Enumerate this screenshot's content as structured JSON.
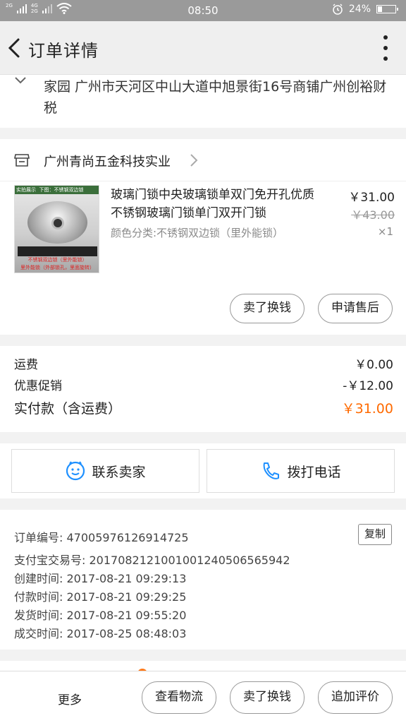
{
  "status_bar": {
    "network1": "2G",
    "network2a": "4G",
    "network2b": "2G",
    "time": "08:50",
    "battery_percent": "24%",
    "battery_level": 0.24
  },
  "header": {
    "title": "订单详情"
  },
  "address": {
    "text": "家园 广州市天河区中山大道中旭景街16号商铺广州创裕财税"
  },
  "shop": {
    "name": "广州青尚五金科技实业"
  },
  "product": {
    "image_tag": "实拍展示",
    "image_tag2": "下图：不锈钢双边锁",
    "image_caption1": "不锈钢双边锁（里外能锁）",
    "image_caption2": "里外能锁（外部锁孔，里面旋转）",
    "title": "玻璃门锁中央玻璃锁单双门免开孔优质不锈钢玻璃门锁单门双开门锁",
    "sku": "颜色分类:不锈钢双边锁（里外能锁）",
    "price": "￥31.00",
    "original_price": "￥43.00",
    "quantity": "×1",
    "btn_refund": "卖了换钱",
    "btn_aftersale": "申请售后"
  },
  "fees": {
    "shipping_label": "运费",
    "shipping_value": "￥0.00",
    "discount_label": "优惠促销",
    "discount_value": "-￥12.00",
    "total_label": "实付款（含运费）",
    "total_value": "￥31.00"
  },
  "contact": {
    "seller_label": "联系卖家",
    "call_label": "拨打电话"
  },
  "order_info": {
    "order_no": "订单编号: 470059761269147​25",
    "alipay_no": "支付宝交易号: 2017082121001001240506565942",
    "created": "创建时间: 2017-08-21 09:29:13",
    "paid": "付款时间: 2017-08-21 09:29:25",
    "shipped": "发货时间: 2017-08-21 09:55:20",
    "completed": "成交时间: 2017-08-25 08:48:03",
    "copy_label": "复制"
  },
  "bottom_bar": {
    "more_label": "更多",
    "logistics_label": "查看物流",
    "sell_label": "卖了换钱",
    "review_label": "追加评价"
  },
  "colors": {
    "accent": "#ff6a00",
    "contact_icon": "#1e90ff",
    "status_bar": "#9a9a9a"
  },
  "icons": {
    "back": "chevron-left-icon",
    "more": "vertical-dots-icon",
    "shop": "store-icon",
    "seller": "smile-chat-icon",
    "phone": "phone-icon"
  }
}
